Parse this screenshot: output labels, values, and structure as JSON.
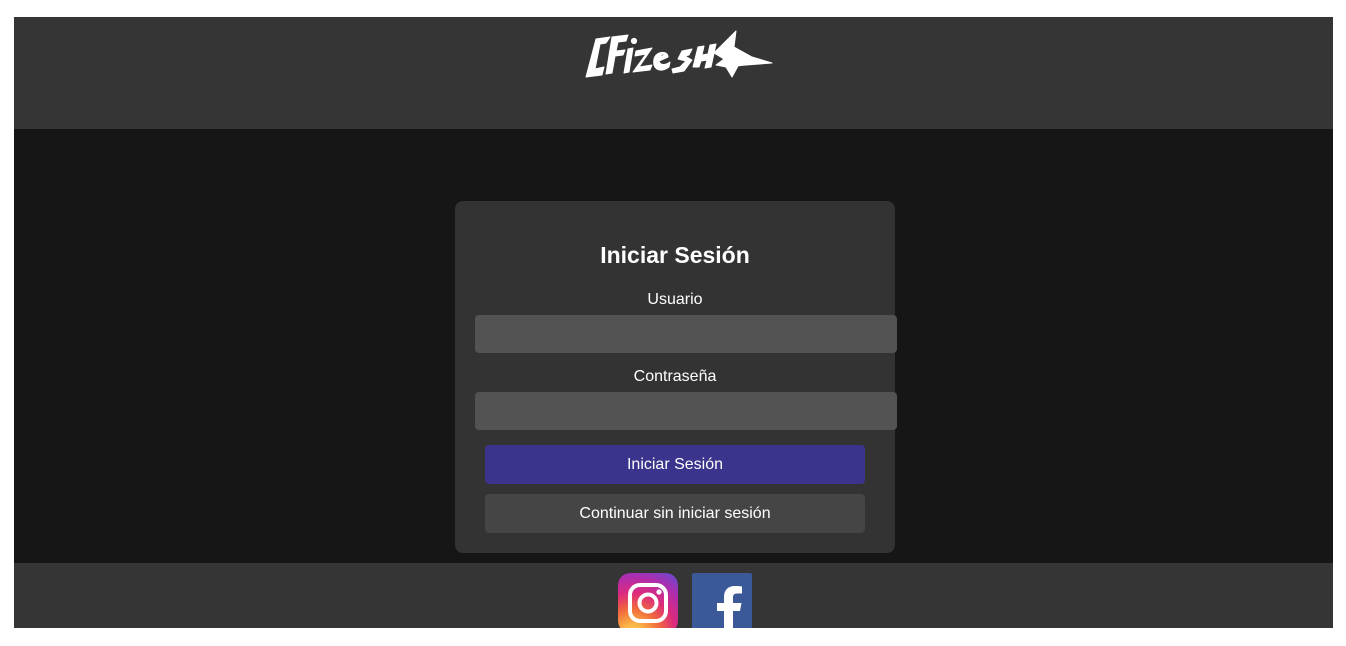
{
  "header": {
    "logo_name": "logo-icon"
  },
  "login": {
    "title": "Iniciar Sesión",
    "username_label": "Usuario",
    "username_value": "",
    "password_label": "Contraseña",
    "password_value": "",
    "submit_label": "Iniciar Sesión",
    "guest_label": "Continuar sin iniciar sesión"
  },
  "footer": {
    "social": [
      {
        "icon": "instagram-icon"
      },
      {
        "icon": "facebook-icon"
      }
    ]
  },
  "colors": {
    "header_bg": "#353535",
    "main_bg": "#161616",
    "card_bg": "#333333",
    "input_bg": "#535353",
    "primary_button": "#3a348c",
    "secondary_button": "#454545",
    "facebook_blue": "#3b5998"
  }
}
